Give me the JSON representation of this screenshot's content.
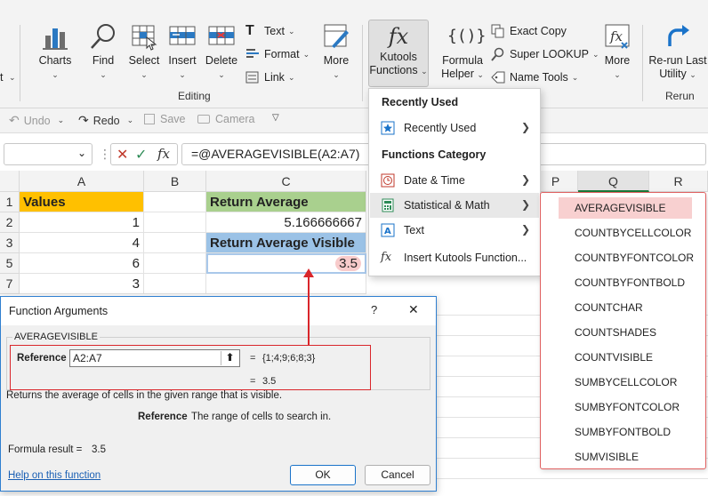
{
  "ribbon": {
    "partial_left": "t",
    "buttons": {
      "charts": "Charts",
      "find": "Find",
      "select": "Select",
      "insert": "Insert",
      "delete": "Delete",
      "more1": "More",
      "kutools_functions_1": "Kutools",
      "kutools_functions_2": "Functions",
      "formula_helper_1": "Formula",
      "formula_helper_2": "Helper",
      "more2": "More",
      "rerun_1": "Re-run Last",
      "rerun_2": "Utility"
    },
    "small": {
      "text": "Text",
      "format": "Format",
      "link": "Link",
      "exact_copy": "Exact Copy",
      "super_lookup": "Super LOOKUP",
      "name_tools": "Name Tools"
    },
    "groups": {
      "editing": "Editing",
      "rerun": "Rerun"
    }
  },
  "qat": {
    "undo": "Undo",
    "redo": "Redo",
    "save": "Save",
    "camera": "Camera"
  },
  "formula_bar": {
    "fx": "fx",
    "formula": "=@AVERAGEVISIBLE(A2:A7)"
  },
  "sheet": {
    "columns": [
      "A",
      "B",
      "C",
      "P",
      "Q",
      "R"
    ],
    "rows": [
      "1",
      "2",
      "3",
      "5",
      "7"
    ],
    "a1": "Values",
    "a2": "1",
    "a3": "4",
    "a5": "6",
    "a7": "3",
    "c1": "Return Average",
    "c2": "5.166666667",
    "c3": "Return Average Visible",
    "c5": "3.5"
  },
  "menu": {
    "header_recent": "Recently Used",
    "item_recent": "Recently Used",
    "header_category": "Functions Category",
    "item_datetime": "Date & Time",
    "item_statmath": "Statistical & Math",
    "item_text": "Text",
    "item_insert": "Insert Kutools Function..."
  },
  "submenu": {
    "items": [
      "AVERAGEVISIBLE",
      "COUNTBYCELLCOLOR",
      "COUNTBYFONTCOLOR",
      "COUNTBYFONTBOLD",
      "COUNTCHAR",
      "COUNTSHADES",
      "COUNTVISIBLE",
      "SUMBYCELLCOLOR",
      "SUMBYFONTCOLOR",
      "SUMBYFONTBOLD",
      "SUMVISIBLE"
    ]
  },
  "dialog": {
    "title": "Function Arguments",
    "help_q": "?",
    "close": "✕",
    "func_name": "AVERAGEVISIBLE",
    "arg_label": "Reference",
    "arg_value": "A2:A7",
    "eq": "=",
    "arg_result": "{1;4;9;6;8;3}",
    "result_eq": "=",
    "result_value": "3.5",
    "description": "Returns the average of cells in the given range that is visible.",
    "param_name": "Reference",
    "param_desc": "The range of cells to search in.",
    "formula_result_label": "Formula result =",
    "formula_result_value": "3.5",
    "help_link": "Help on this function",
    "ok": "OK",
    "cancel": "Cancel"
  },
  "colors": {
    "header_yellow": "#ffc000",
    "header_green": "#a9d08e",
    "header_blue": "#9bc2e6",
    "highlight_pink": "#f8cbcb",
    "annotation_red": "#d9262b",
    "accent_blue": "#1a73c9"
  }
}
